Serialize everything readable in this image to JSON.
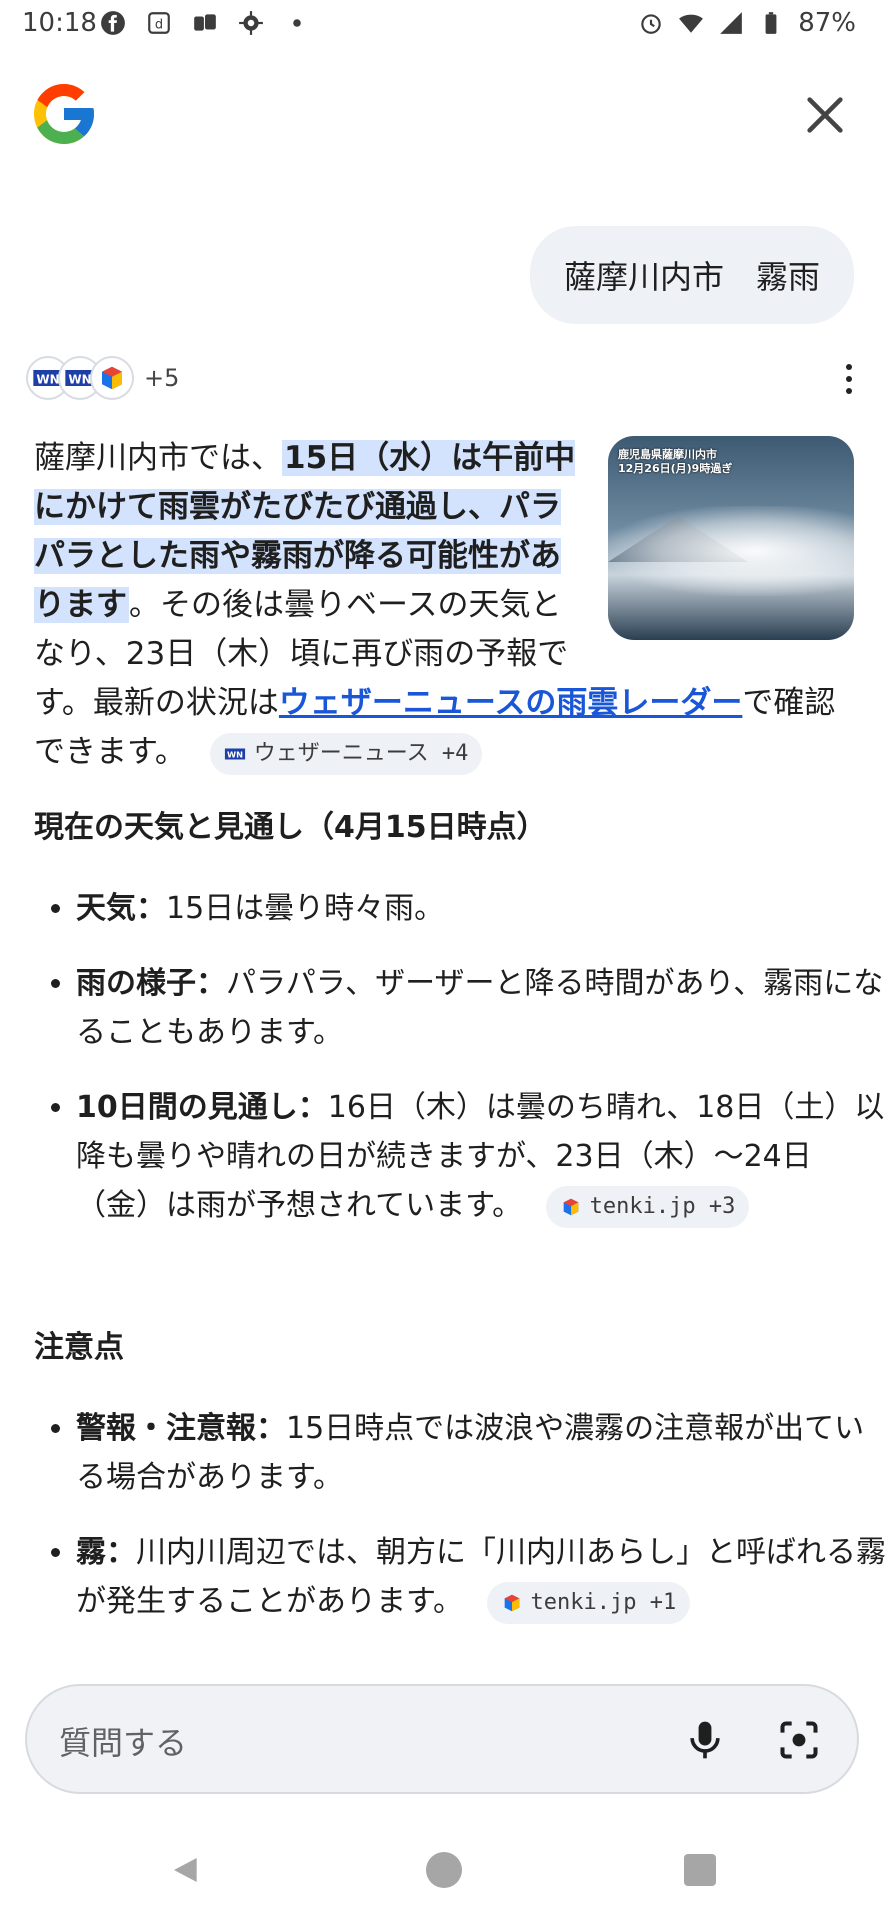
{
  "status": {
    "time": "10:18",
    "battery": "87%",
    "left_icons": [
      "facebook-icon",
      "d-app-icon",
      "cards-app-icon",
      "gear-icon",
      "dot-icon"
    ],
    "right_icons": [
      "alarm-icon",
      "wifi-icon",
      "signal-icon",
      "battery-icon"
    ]
  },
  "query": "薩摩川内市　霧雨",
  "sources": {
    "more": "+5"
  },
  "answer": {
    "intro": "薩摩川内市では、",
    "highlight": "15日（水）は午前中にかけて雨雲がたびたび通過し、パラパラとした雨や霧雨が降る可能性があります",
    "after": "。その後は曇りベースの天気となり、23日（木）頃に再び雨の予報です。最新の状況は",
    "link": "ウェザーニュースの雨雲レーダー",
    "tail": "で確認できます。",
    "chip": "ウェザーニュース +4",
    "thumb_caption_1": "鹿児島県薩摩川内市",
    "thumb_caption_2": "12月26日(月)9時過ぎ"
  },
  "section1": {
    "heading": "現在の天気と見通し（4月15日時点）",
    "items": [
      {
        "label": "天気",
        "text": "15日は曇り時々雨。"
      },
      {
        "label": "雨の様子",
        "text": "パラパラ、ザーザーと降る時間があり、霧雨になることもあります。"
      },
      {
        "label": "10日間の見通し",
        "text": "16日（木）は曇のち晴れ、18日（土）以降も曇りや晴れの日が続きますが、23日（木）〜24日（金）は雨が予想されています。"
      }
    ],
    "chip": "tenki.jp +3"
  },
  "section2": {
    "heading": "注意点",
    "items": [
      {
        "label": "警報・注意報",
        "text": "15日時点では波浪や濃霧の注意報が出ている場合があります。"
      },
      {
        "label": "霧",
        "text": "川内川周辺では、朝方に「川内川あらし」と呼ばれる霧が発生することがあります。"
      }
    ],
    "chip": "tenki.jp +1"
  },
  "input": {
    "placeholder": "質問する"
  },
  "colors": {
    "highlight": "#d3e3fd",
    "link": "#1a57d8",
    "chip_bg": "#eef1f6"
  }
}
